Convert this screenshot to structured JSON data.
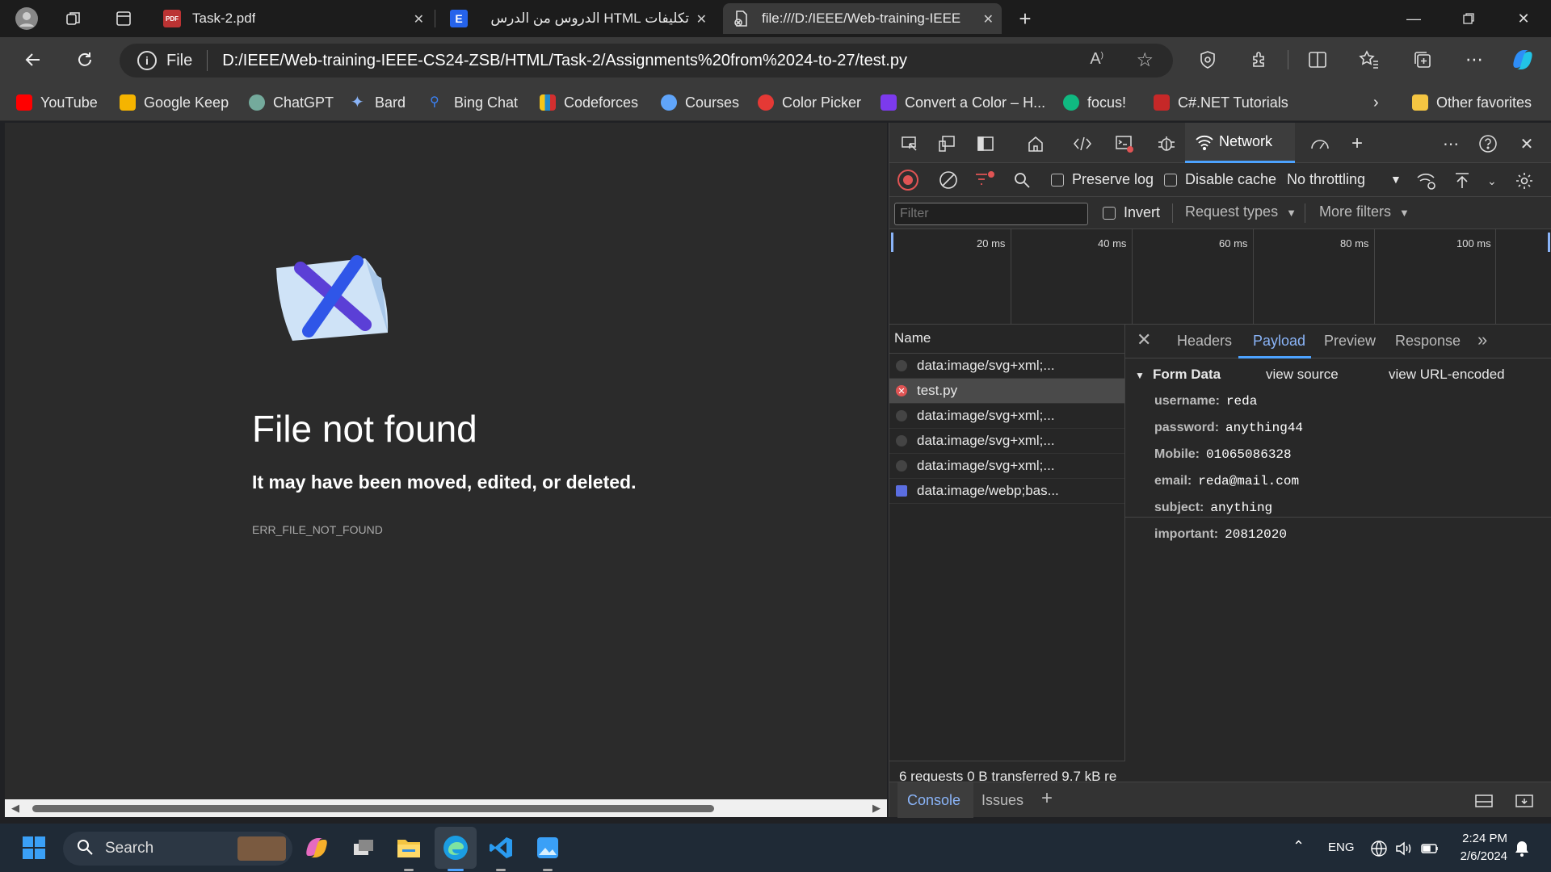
{
  "tabs": [
    {
      "label": "Task-2.pdf",
      "icon": "pdf-icon"
    },
    {
      "label": "تكليفات HTML الدروس من الدرس",
      "icon": "e-site-icon"
    },
    {
      "label": "file:///D:/IEEE/Web-training-IEEE",
      "icon": "broken-file-icon"
    }
  ],
  "address": {
    "scheme": "File",
    "url": "D:/IEEE/Web-training-IEEE-CS24-ZSB/HTML/Task-2/Assignments%20from%2024-to-27/test.py"
  },
  "bookmarks": [
    {
      "label": "YouTube",
      "color": "#ff0000"
    },
    {
      "label": "Google Keep",
      "color": "#f5b400"
    },
    {
      "label": "ChatGPT",
      "color": "#74aa9c"
    },
    {
      "label": "Bard",
      "color": "#8ab4f8"
    },
    {
      "label": "Bing Chat",
      "color": "#3b82f6"
    },
    {
      "label": "Codeforces",
      "color": "#1f8acb"
    },
    {
      "label": "Courses",
      "color": "#60a5fa"
    },
    {
      "label": "Color Picker",
      "color": "#e53935"
    },
    {
      "label": "Convert a Color – H...",
      "color": "#7c3aed"
    },
    {
      "label": "focus!",
      "color": "#10b981"
    },
    {
      "label": "C#.NET Tutorials",
      "color": "#c62828"
    }
  ],
  "other_favorites": "Other favorites",
  "error": {
    "title": "File not found",
    "subtitle": "It may have been moved, edited, or deleted.",
    "code": "ERR_FILE_NOT_FOUND"
  },
  "devtools": {
    "network_tab": "Network",
    "preserve_log": "Preserve log",
    "disable_cache": "Disable cache",
    "throttling": "No throttling",
    "filter_placeholder": "Filter",
    "invert": "Invert",
    "request_types": "Request types",
    "more_filters": "More filters",
    "ticks": [
      "20 ms",
      "40 ms",
      "60 ms",
      "80 ms",
      "100 ms"
    ],
    "name_header": "Name",
    "requests": [
      "data:image/svg+xml;...",
      "test.py",
      "data:image/svg+xml;...",
      "data:image/svg+xml;...",
      "data:image/svg+xml;...",
      "data:image/webp;bas..."
    ],
    "detail_tabs": [
      "Headers",
      "Payload",
      "Preview",
      "Response"
    ],
    "form_data": {
      "title": "Form Data",
      "view_source": "view source",
      "view_url": "view URL-encoded",
      "fields": [
        {
          "key": "username:",
          "value": "reda"
        },
        {
          "key": "password:",
          "value": "anything44"
        },
        {
          "key": "Mobile:",
          "value": "01065086328"
        },
        {
          "key": "email:",
          "value": "reda@mail.com"
        },
        {
          "key": "subject:",
          "value": "anything"
        },
        {
          "key": "important:",
          "value": "20812020"
        }
      ]
    },
    "summary": "6 requests   0 B transferred   9.7 kB re",
    "drawer": {
      "console": "Console",
      "issues": "Issues"
    }
  },
  "taskbar": {
    "search": "Search",
    "lang": "ENG",
    "time": "2:24 PM",
    "date": "2/6/2024"
  }
}
